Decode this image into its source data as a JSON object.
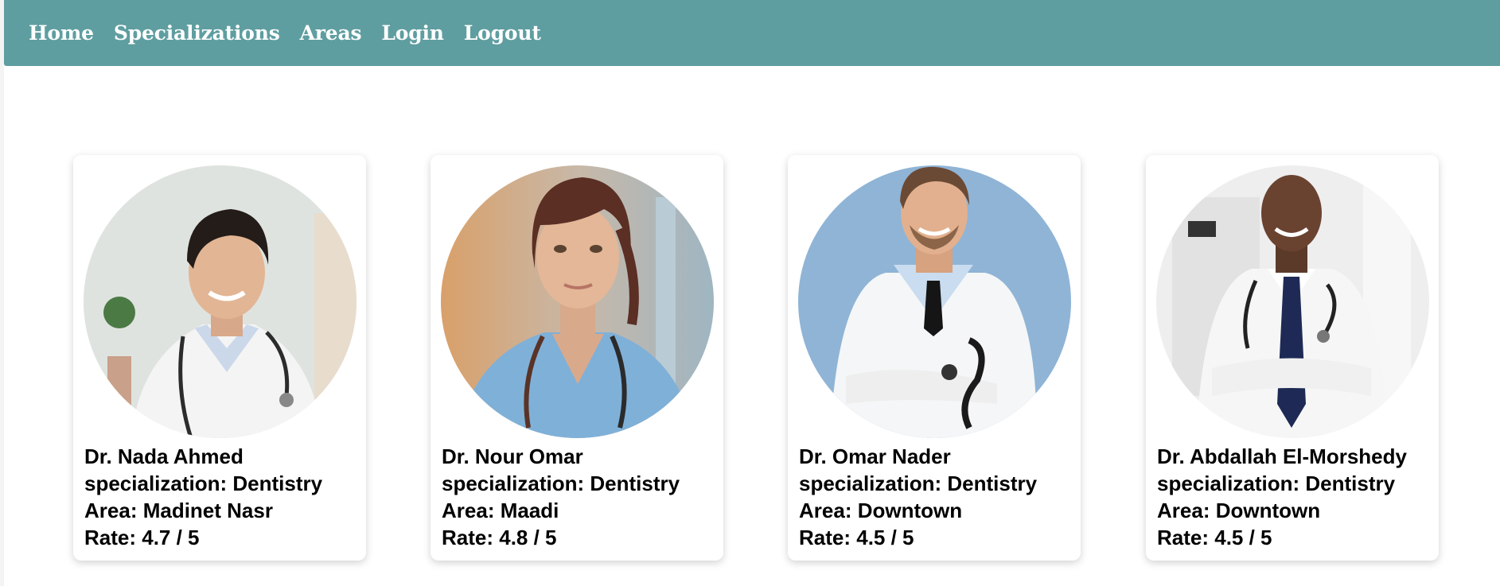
{
  "nav": {
    "home": "Home",
    "specializations": "Specializations",
    "areas": "Areas",
    "login": "Login",
    "logout": "Logout"
  },
  "doctors": [
    {
      "name": "Dr. Nada Ahmed",
      "specialization": "specialization: Dentistry",
      "area": "Area: Madinet Nasr",
      "rate": "Rate: 4.7 / 5",
      "photo": "female-doctor-white-coat-photo"
    },
    {
      "name": "Dr. Nour Omar",
      "specialization": "specialization: Dentistry",
      "area": "Area: Maadi",
      "rate": "Rate: 4.8 / 5",
      "photo": "female-doctor-blue-scrubs-photo"
    },
    {
      "name": "Dr. Omar Nader",
      "specialization": "specialization: Dentistry",
      "area": "Area: Downtown",
      "rate": "Rate: 4.5 / 5",
      "photo": "male-doctor-blue-background-photo"
    },
    {
      "name": "Dr. Abdallah El-Morshedy",
      "specialization": "specialization: Dentistry",
      "area": "Area: Downtown",
      "rate": "Rate: 4.5 / 5",
      "photo": "male-doctor-clinic-photo"
    }
  ],
  "colors": {
    "navbar": "#5f9ea0",
    "nav_text": "#ffffff",
    "card_text": "#000000"
  }
}
